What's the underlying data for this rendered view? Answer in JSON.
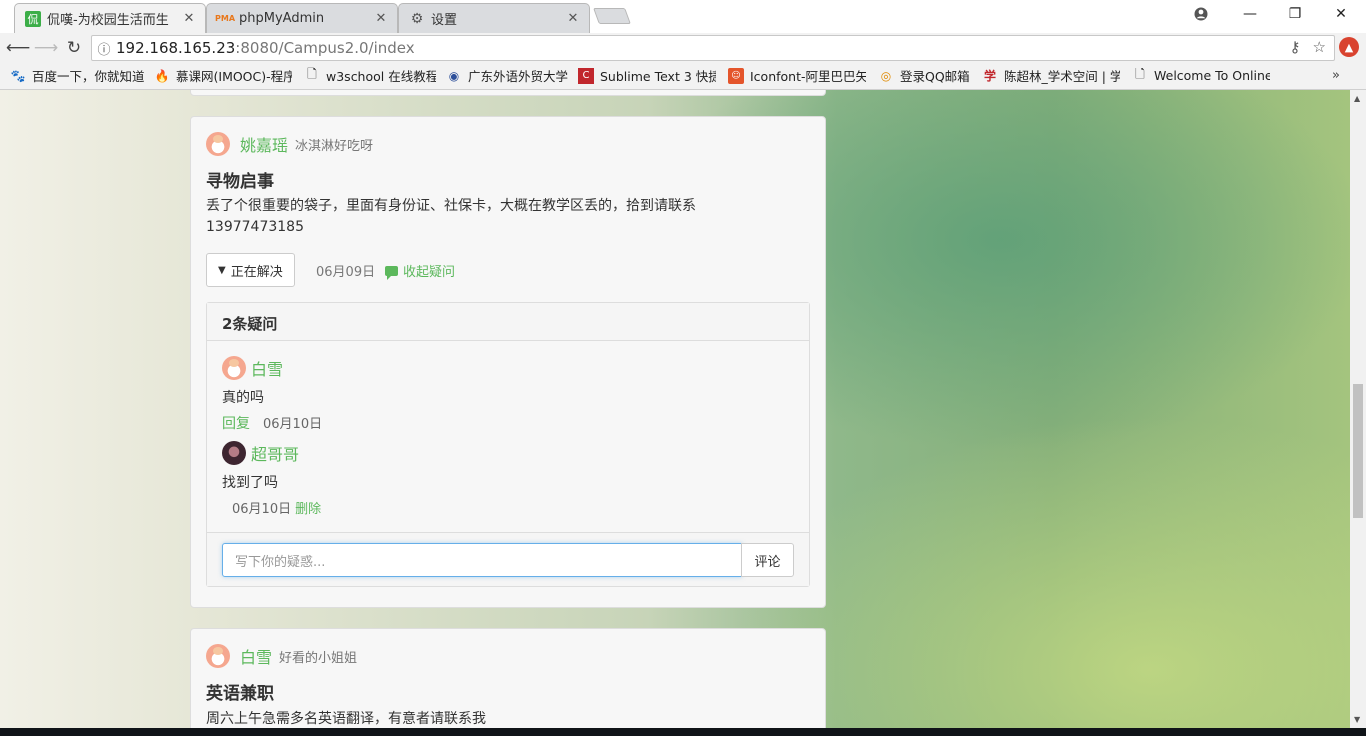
{
  "browser": {
    "tabs": [
      {
        "title": "侃嘆-为校园生活而生",
        "favicon": "侃",
        "active": true
      },
      {
        "title": "phpMyAdmin",
        "favicon": "PMA",
        "active": false
      },
      {
        "title": "设置",
        "favicon": "gear",
        "active": false
      }
    ],
    "url_host": "192.168.165.23",
    "url_path": ":8080/Campus2.0/index",
    "bookmarks": [
      "百度一下，你就知道",
      "慕课网(IMOOC)-程序",
      "w3school 在线教程",
      "广东外语外贸大学",
      "Sublime Text 3 快捷",
      "Iconfont-阿里巴巴矢",
      "登录QQ邮箱",
      "陈超林_学术空间 | 学",
      "Welcome To Online"
    ]
  },
  "post": {
    "author": "姚嘉瑶",
    "signature": "冰淇淋好吃呀",
    "title": "寻物启事",
    "body": "丢了个很重要的袋子，里面有身份证、社保卡，大概在教学区丢的，拾到请联系13977473185",
    "status": "正在解决",
    "date": "06月09日",
    "toggle_label": "收起疑问",
    "comments_header": "2条疑问",
    "comments": [
      {
        "author": "白雪",
        "text": "真的吗",
        "action": "回复",
        "date": "06月10日"
      },
      {
        "author": "超哥哥",
        "text": "找到了吗",
        "date": "06月10日",
        "action": "删除"
      }
    ],
    "comment_placeholder": "写下你的疑惑...",
    "comment_submit": "评论"
  },
  "next_post": {
    "author": "白雪",
    "signature": "好看的小姐姐",
    "title": "英语兼职",
    "body": "周六上午急需多名英语翻译，有意者请联系我"
  }
}
